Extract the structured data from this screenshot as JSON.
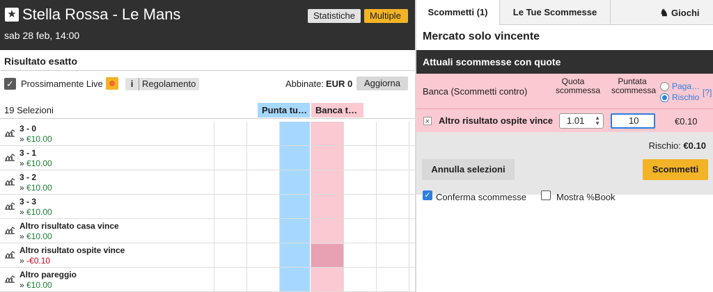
{
  "event": {
    "title": "Stella Rossa - Le Mans",
    "date": "sab 28 feb, 14:00",
    "stats_label": "Statistiche",
    "multiple_label": "Multiple"
  },
  "market": {
    "title": "Risultato esatto",
    "live_label": "Prossimamente Live",
    "rules_label": "Regolamento",
    "matched_label": "Abbinate:",
    "matched_value": "EUR 0",
    "refresh_label": "Aggiorna",
    "selection_count": "19 Selezioni",
    "back_header": "Punta tu…",
    "lay_header": "Banca t…"
  },
  "runners": [
    {
      "name": "3 - 0",
      "pl_prefix": "»",
      "pl": "€10.00",
      "negative": false
    },
    {
      "name": "3 - 1",
      "pl_prefix": "»",
      "pl": "€10.00",
      "negative": false
    },
    {
      "name": "3 - 2",
      "pl_prefix": "»",
      "pl": "€10.00",
      "negative": false
    },
    {
      "name": "3 - 3",
      "pl_prefix": "»",
      "pl": "€10.00",
      "negative": false
    },
    {
      "name": "Altro risultato casa vince",
      "pl_prefix": "»",
      "pl": "€10.00",
      "negative": false
    },
    {
      "name": "Altro risultato ospite vince",
      "pl_prefix": "»",
      "pl": "-€0.10",
      "negative": true
    },
    {
      "name": "Altro pareggio",
      "pl_prefix": "»",
      "pl": "€10.00",
      "negative": false
    }
  ],
  "betslip": {
    "tabs": {
      "bets": "Scommetti (1)",
      "my_bets": "Le Tue Scommesse",
      "games": "Giochi"
    },
    "market_name": "Mercato solo vincente",
    "section_title": "Attuali scommesse con quote",
    "lay_title": "Banca (Scommetti contro)",
    "odds_header": "Quota scommessa",
    "stake_header": "Puntata scommessa",
    "radio_pay": "Paga…",
    "radio_risk": "Rischio",
    "help": "[?]",
    "bet": {
      "remove": "×",
      "selection": "Altro risultato ospite vince",
      "odds": "1.01",
      "stake": "10",
      "liability": "€0.10"
    },
    "risk_label": "Rischio:",
    "risk_value": "€0.10",
    "cancel_label": "Annulla selezioni",
    "submit_label": "Scommetti",
    "confirm_label": "Conferma scommesse",
    "show_book_label": "Mostra %Book"
  }
}
